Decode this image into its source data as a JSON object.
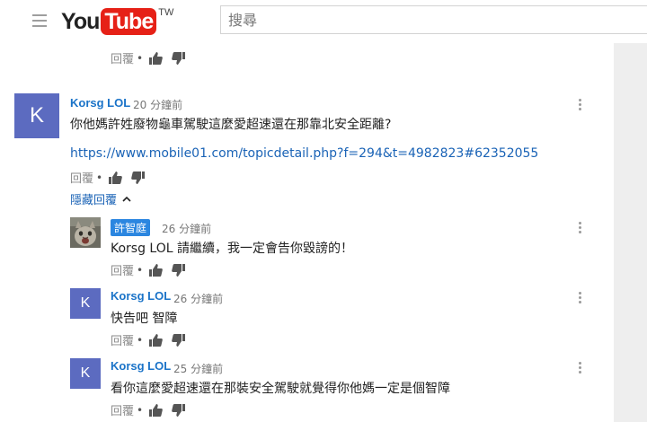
{
  "header": {
    "logo_you": "You",
    "logo_tube": "Tube",
    "logo_region": "TW",
    "search_placeholder": "搜尋"
  },
  "labels": {
    "reply": "回覆",
    "dot": "•",
    "hide_replies": "隱藏回覆"
  },
  "comments": [
    {
      "author": "Korsg LOL",
      "time": "20 分鐘前",
      "avatar_letter": "K",
      "text": "你他媽許姓廢物龜車駕駛這麼愛超速還在那靠北安全距離?",
      "link": "https://www.mobile01.com/topicdetail.php?f=294&t=4982823#62352055"
    }
  ],
  "replies": [
    {
      "author": "許智庭",
      "time": "26 分鐘前",
      "text": "Korsg LOL 請繼續，我一定會告你毀謗的！"
    },
    {
      "author": "Korsg LOL",
      "time": "26 分鐘前",
      "avatar_letter": "K",
      "text": "快告吧 智障"
    },
    {
      "author": "Korsg LOL",
      "time": "25 分鐘前",
      "avatar_letter": "K",
      "text": "看你這麼愛超速還在那裝安全駕駛就覺得你他媽一定是個智障"
    }
  ],
  "colors": {
    "avatar_bg": "#5c6bc0",
    "link": "#1a63b6",
    "author": "#1a73c8",
    "badge": "#2b86e0",
    "logo_red": "#e62117"
  }
}
